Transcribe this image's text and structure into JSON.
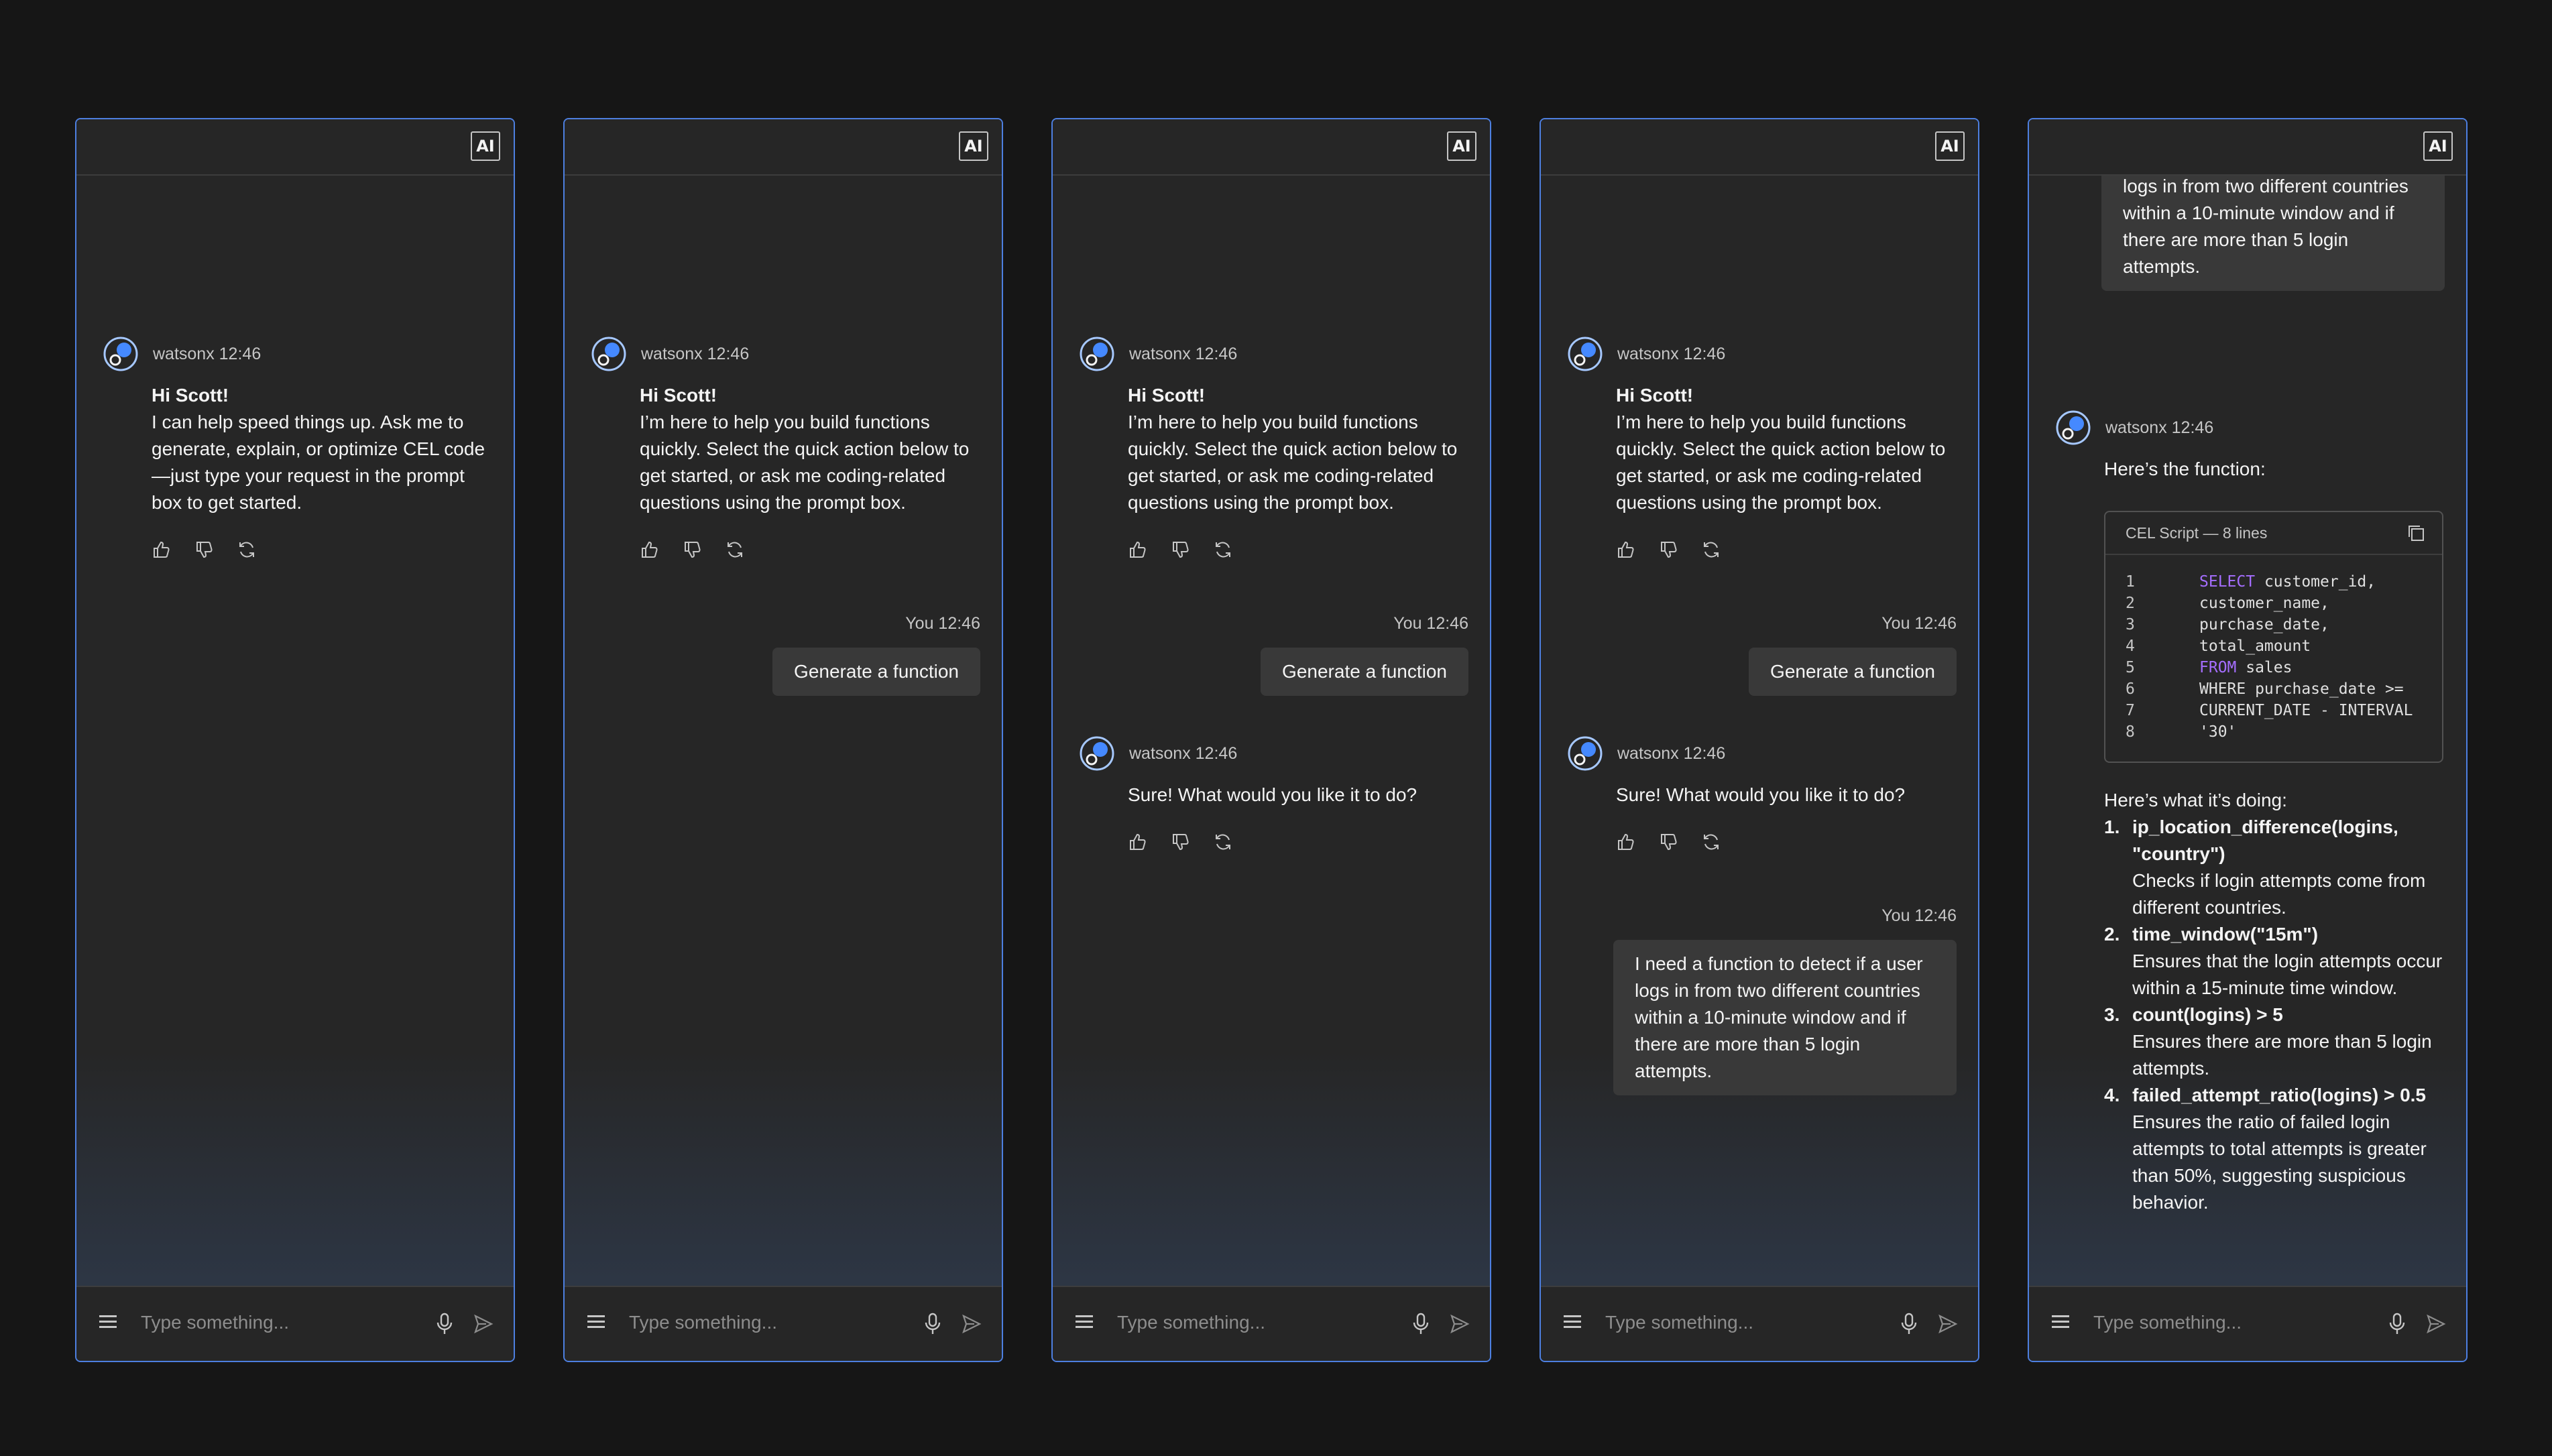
{
  "ai_badge": "AI",
  "input_placeholder": "Type something...",
  "bot_meta": "watsonx 12:46",
  "user_meta": "You 12:46",
  "colors": {
    "panel_border": "#4d7fe0",
    "background": "#161616",
    "keyword": "#a56eff"
  },
  "panel1": {
    "greeting": "Hi Scott!",
    "intro": "I can help speed things up. Ask me to generate, explain, or optimize CEL code—just type your request in the prompt box to get started."
  },
  "greeting": "Hi Scott!",
  "intro": "I’m here to help you build functions quickly. Select the quick action below to get started, or ask me coding-related questions using the prompt box.",
  "quick_action": "Generate a function",
  "bot_reply": "Sure! What would you like it to do?",
  "user_request": "I need a function to detect if a user logs in from two different countries within a 10-minute window and if there are more than 5 login attempts.",
  "panel5": {
    "function_intro": "Here’s the function:",
    "code_title": "CEL Script — 8 lines",
    "code": [
      {
        "n": "1",
        "kw": "SELECT",
        "rest": " customer_id,"
      },
      {
        "n": "2",
        "kw": "",
        "rest": "customer_name,"
      },
      {
        "n": "3",
        "kw": "",
        "rest": "purchase_date,"
      },
      {
        "n": "4",
        "kw": "",
        "rest": "total_amount"
      },
      {
        "n": "5",
        "kw": "FROM",
        "rest": " sales"
      },
      {
        "n": "6",
        "kw": "",
        "rest": "WHERE purchase_date >="
      },
      {
        "n": "7",
        "kw": "",
        "rest": "CURRENT_DATE - INTERVAL"
      },
      {
        "n": "8",
        "kw": "",
        "rest": "'30'"
      }
    ],
    "doing_intro": "Here’s what it’s doing:",
    "steps": [
      {
        "num": "1.",
        "title": "ip_location_difference(logins, \"country\")",
        "desc": "Checks if login attempts come from different countries."
      },
      {
        "num": "2.",
        "title": "time_window(\"15m\")",
        "desc": "Ensures that the login attempts occur within a 15-minute time window."
      },
      {
        "num": "3.",
        "title": "count(logins) > 5",
        "desc": "Ensures there are more than 5 login attempts."
      },
      {
        "num": "4.",
        "title": "failed_attempt_ratio(logins) > 0.5",
        "desc": "Ensures the ratio of failed login attempts to total attempts is greater than 50%, suggesting suspicious behavior."
      }
    ]
  }
}
